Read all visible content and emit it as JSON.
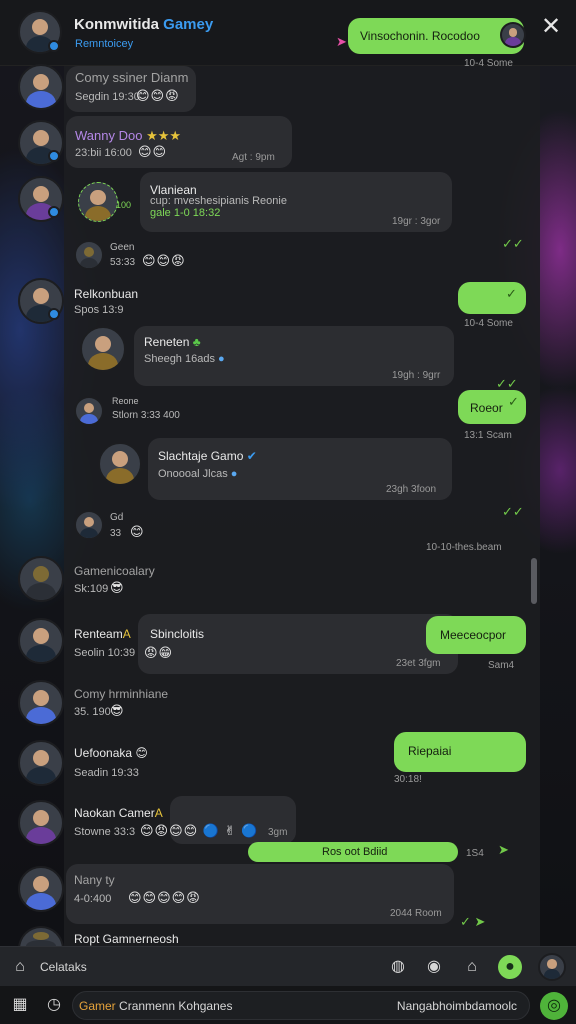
{
  "header": {
    "title": "Konmwitida Gamey",
    "title_accent": "Gamey",
    "title_main": "Konmwitida ",
    "subtitle": "Remntoicey",
    "pinned_message": "Vinsochonin. Rocodoo",
    "pinned_time": "10-4 Some",
    "close_symbol": "✕"
  },
  "messages": [
    {
      "name": "Comy ssiner Dianm",
      "sub": "Segdin 19:30",
      "emoji": "😊😊😡"
    },
    {
      "name": "Wanny Doo",
      "name_tag": "★★★",
      "sub": "23:bii 16:00",
      "emoji": "😊😊",
      "time": "Agt : 9pm"
    },
    {
      "quote_name": "Vlaniean",
      "quote_line": "cup: mveshesipianis Reonie",
      "quote_line2": "gale 1-0 18:32",
      "time": "19gr : 3gor",
      "side_tag": "100"
    },
    {
      "name": "Geen",
      "sub": "53:33",
      "emoji": "😊😊😡"
    },
    {
      "name": "Relkonbuan",
      "sub": "Spos 13:9"
    },
    {
      "name": "Reneten",
      "sub": "Sheegh 16ads",
      "time": "19gh : 9grr"
    },
    {
      "out": "",
      "time": "10-4 Some"
    },
    {
      "name": "Reone",
      "sub": "Stlorn 3:33 400"
    },
    {
      "out": "Roeor",
      "time": "13:1 Scam"
    },
    {
      "name": "Slachtaje Gamo",
      "sub": "Onoooal Jlcas",
      "time": "23gh 3foon"
    },
    {
      "name": "Gd",
      "sub": "33",
      "emoji": "😊"
    },
    {
      "time": "10-10-thes.beam"
    },
    {
      "name": "Gamenicoalary",
      "sub": "Sk:109",
      "emoji": "😎"
    },
    {
      "name": "Renteam",
      "badge": "A",
      "name2": "Sbincloitis",
      "sub": "Seolin 10:39",
      "emoji": "😡😁",
      "out": "Meeceocpor",
      "time": "23et 3fgm",
      "time2": "Sam4"
    },
    {
      "name": "Comy hrminhiane",
      "sub": "35. 190",
      "emoji": "😎"
    },
    {
      "name": "Uefoonaka",
      "sub": "Seadin 19:33",
      "out": "Riepaiai",
      "time": "30:18!"
    },
    {
      "name": "Naokan Camer",
      "badge": "A",
      "sub": "Stowne 33:3",
      "emoji": "😊😡😊😊 🔵 ✌ 🔵",
      "tail": "3gm",
      "out": "Ros oot Bdiid",
      "out_time": "1S4"
    },
    {
      "name": "Nany ty",
      "sub": "4-0:400",
      "emoji": "😊😊😊😊😡",
      "time": "2044 Room"
    },
    {
      "name": "Ropt Gamnerneosh"
    }
  ],
  "toolbar": {
    "label": "Celataks"
  },
  "bottom": {
    "search_prefix": "Gamer",
    "search_text": "Cranmenn Kohganes",
    "search_right": "Nangabhoimbdamoolc"
  },
  "colors": {
    "accent": "#7ed957",
    "link": "#3b9bf0",
    "panel": "#1c1d20"
  }
}
